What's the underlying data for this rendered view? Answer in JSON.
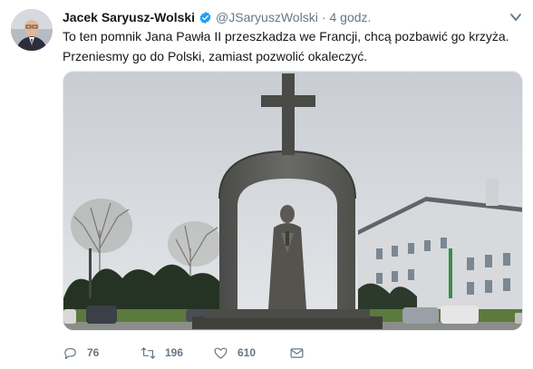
{
  "tweet": {
    "author_name": "Jacek Saryusz-Wolski",
    "handle": "@JSaryuszWolski",
    "separator": "·",
    "time": "4 godz.",
    "text_lines": [
      "To ten pomnik Jana Pawła II przeszkadza we Francji, chcą pozbawić go krzyża.",
      "Przeniesmy go do Polski, zamiast pozwolić okaleczyć."
    ],
    "actions": {
      "replies": "76",
      "retweets": "196",
      "likes": "610"
    }
  },
  "icons": {
    "verified": "verified-badge-icon",
    "menu": "chevron-down-icon",
    "reply": "reply-icon",
    "retweet": "retweet-icon",
    "like": "heart-icon",
    "message": "envelope-icon"
  },
  "colors": {
    "verified": "#1da1f2",
    "secondary_text": "#657786"
  }
}
